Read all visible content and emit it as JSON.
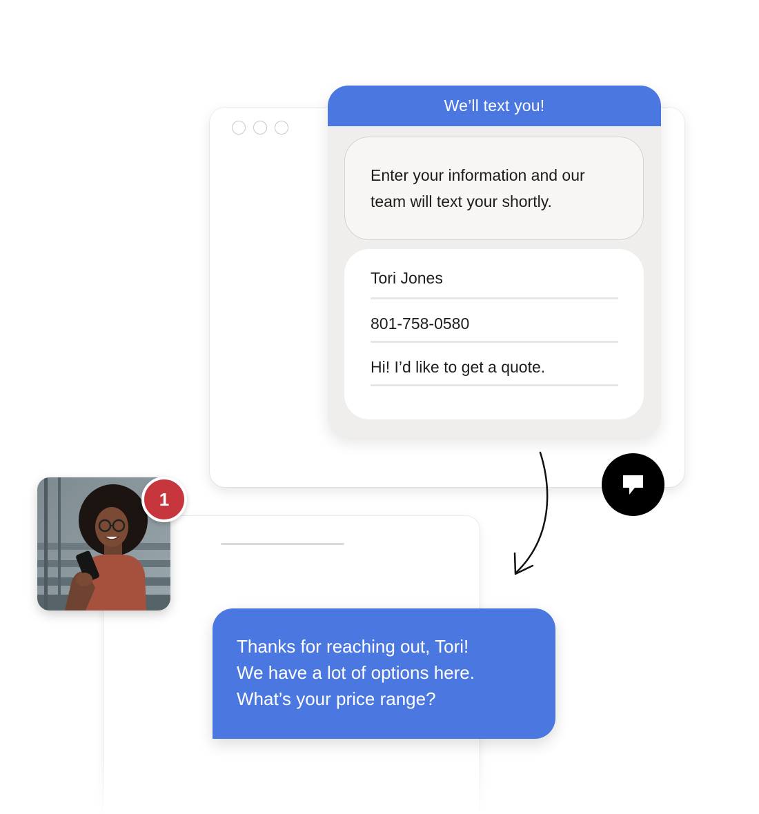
{
  "widget": {
    "header_title": "We’ll text you!",
    "intro_text": "Enter your information and our team will text your shortly.",
    "form": {
      "name_value": "Tori Jones",
      "phone_value": "801-758-0580",
      "message_value": "Hi! I’d like to get a quote."
    }
  },
  "reply": {
    "lines": [
      "Thanks for reaching out, Tori!",
      "We have a lot of options here.",
      "What’s your price range?"
    ]
  },
  "notification": {
    "count": "1"
  },
  "colors": {
    "brand_blue": "#4a77e0",
    "badge_red": "#c7353d",
    "widget_background": "#efeeec"
  },
  "icons": {
    "logo": "brand-logo-icon",
    "arrow": "curved-arrow-icon"
  }
}
